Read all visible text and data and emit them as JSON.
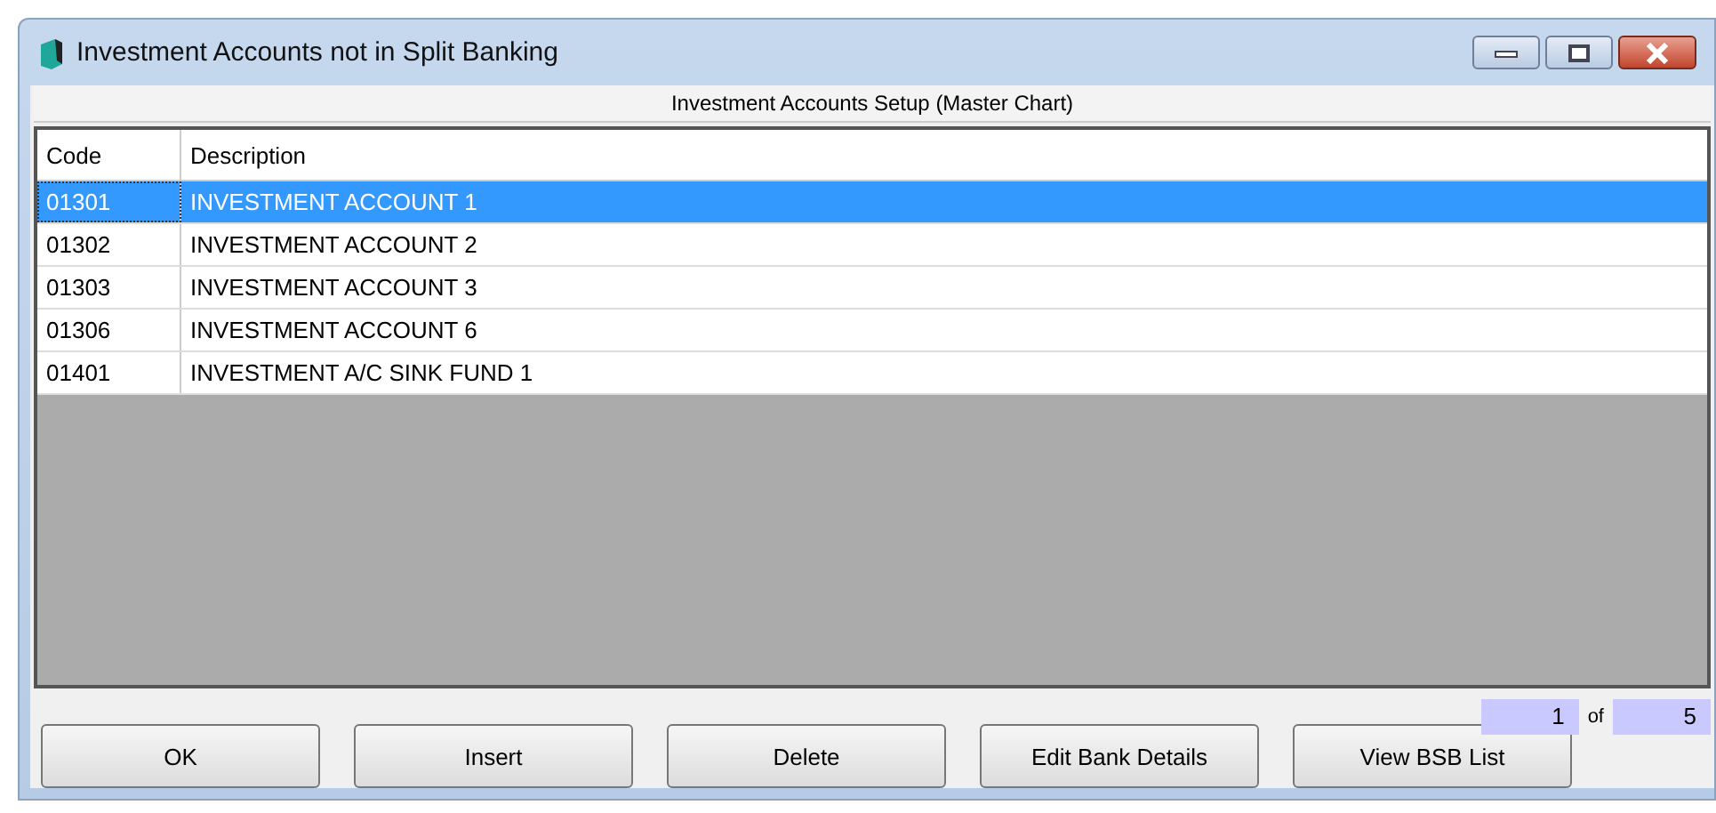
{
  "window": {
    "title": "Investment Accounts not in Split Banking"
  },
  "grid_title": "Investment Accounts Setup (Master Chart)",
  "table": {
    "columns": [
      "Code",
      "Description"
    ],
    "rows": [
      {
        "code": "01301",
        "description": "INVESTMENT ACCOUNT 1",
        "selected": true
      },
      {
        "code": "01302",
        "description": "INVESTMENT ACCOUNT 2",
        "selected": false
      },
      {
        "code": "01303",
        "description": "INVESTMENT ACCOUNT 3",
        "selected": false
      },
      {
        "code": "01306",
        "description": "INVESTMENT ACCOUNT 6",
        "selected": false
      },
      {
        "code": "01401",
        "description": "INVESTMENT A/C SINK FUND 1",
        "selected": false
      }
    ]
  },
  "buttons": [
    "OK",
    "Insert",
    "Delete",
    "Edit Bank Details",
    "View BSB List"
  ],
  "record_counter": {
    "current": "1",
    "of_label": "of",
    "total": "5"
  }
}
